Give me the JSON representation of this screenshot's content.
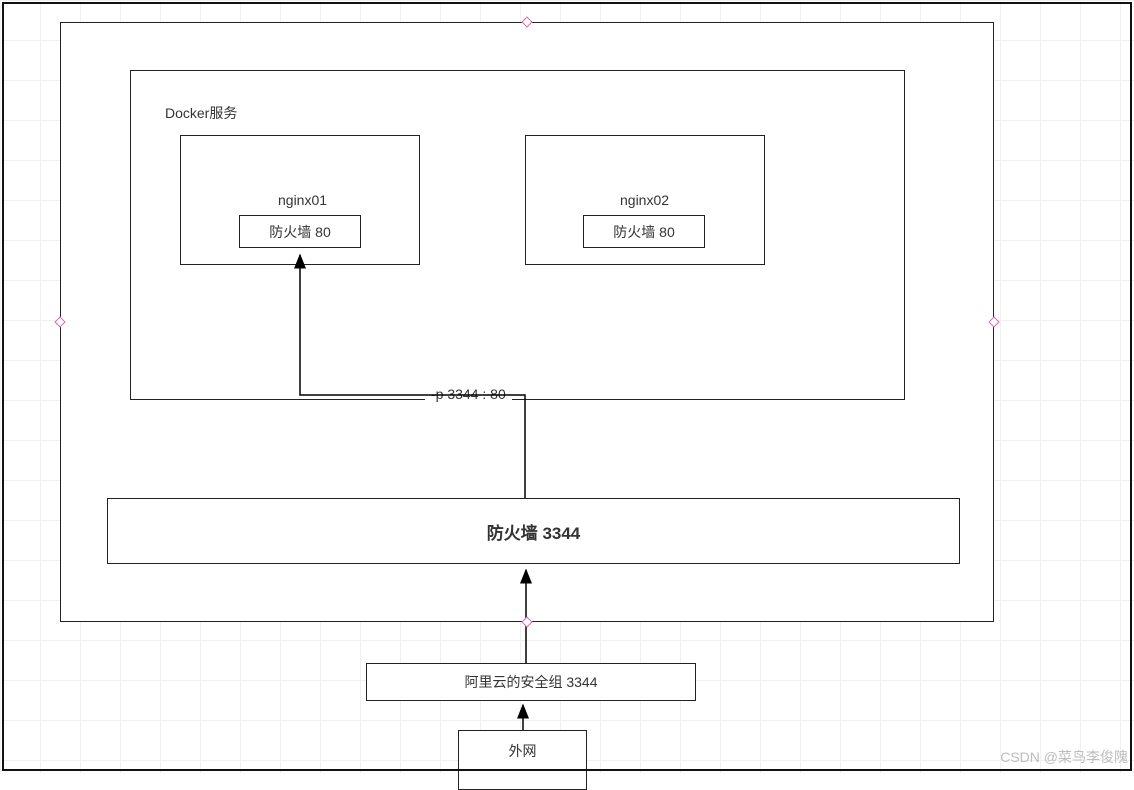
{
  "docker_service_label": "Docker服务",
  "nginx01_label": "nginx01",
  "nginx02_label": "nginx02",
  "firewall80_label": "防火墙 80",
  "port_mapping_label": "-p 3344 : 80",
  "firewall3344_label": "防火墙  3344",
  "security_group_label": "阿里云的安全组  3344",
  "external_label": "外网",
  "watermark": "CSDN @菜鸟李俊隗"
}
